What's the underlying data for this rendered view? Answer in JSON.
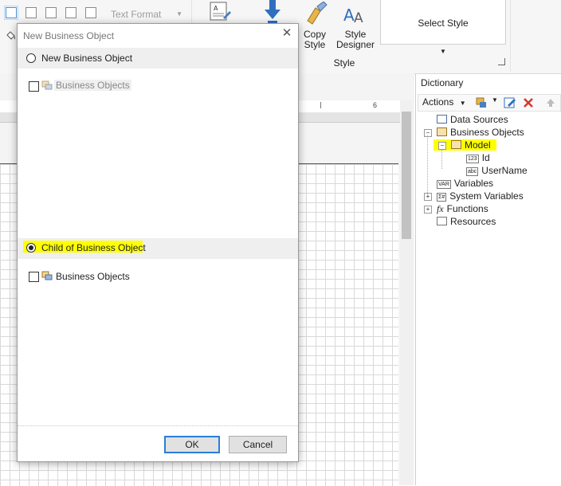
{
  "ribbon": {
    "text_format": "Text Format",
    "copy_style_line1": "Copy",
    "copy_style_line2": "Style",
    "style_designer_line1": "Style",
    "style_designer_line2": "Designer",
    "style_group": "Style",
    "select_style": "Select Style"
  },
  "ruler": {
    "mark": "6"
  },
  "dictionary": {
    "title": "Dictionary",
    "actions": "Actions",
    "items": {
      "data_sources": "Data Sources",
      "business_objects": "Business Objects",
      "model": "Model",
      "id": "Id",
      "username": "UserName",
      "variables": "Variables",
      "system_variables": "System Variables",
      "functions": "Functions",
      "resources": "Resources"
    },
    "icons": {
      "id": "123",
      "username": "abc",
      "variables": "VAR",
      "system_variables": "Σ#",
      "functions": "fx"
    }
  },
  "dialog": {
    "title": "New Business Object",
    "option_new": "New Business Object",
    "new_list_item": "Business Objects",
    "option_child": "Child of Business Object",
    "child_list_item": "Business Objects",
    "ok": "OK",
    "cancel": "Cancel",
    "selected_option": "child"
  },
  "colors": {
    "highlight": "#ffff00",
    "accent": "#2a7ed8"
  }
}
